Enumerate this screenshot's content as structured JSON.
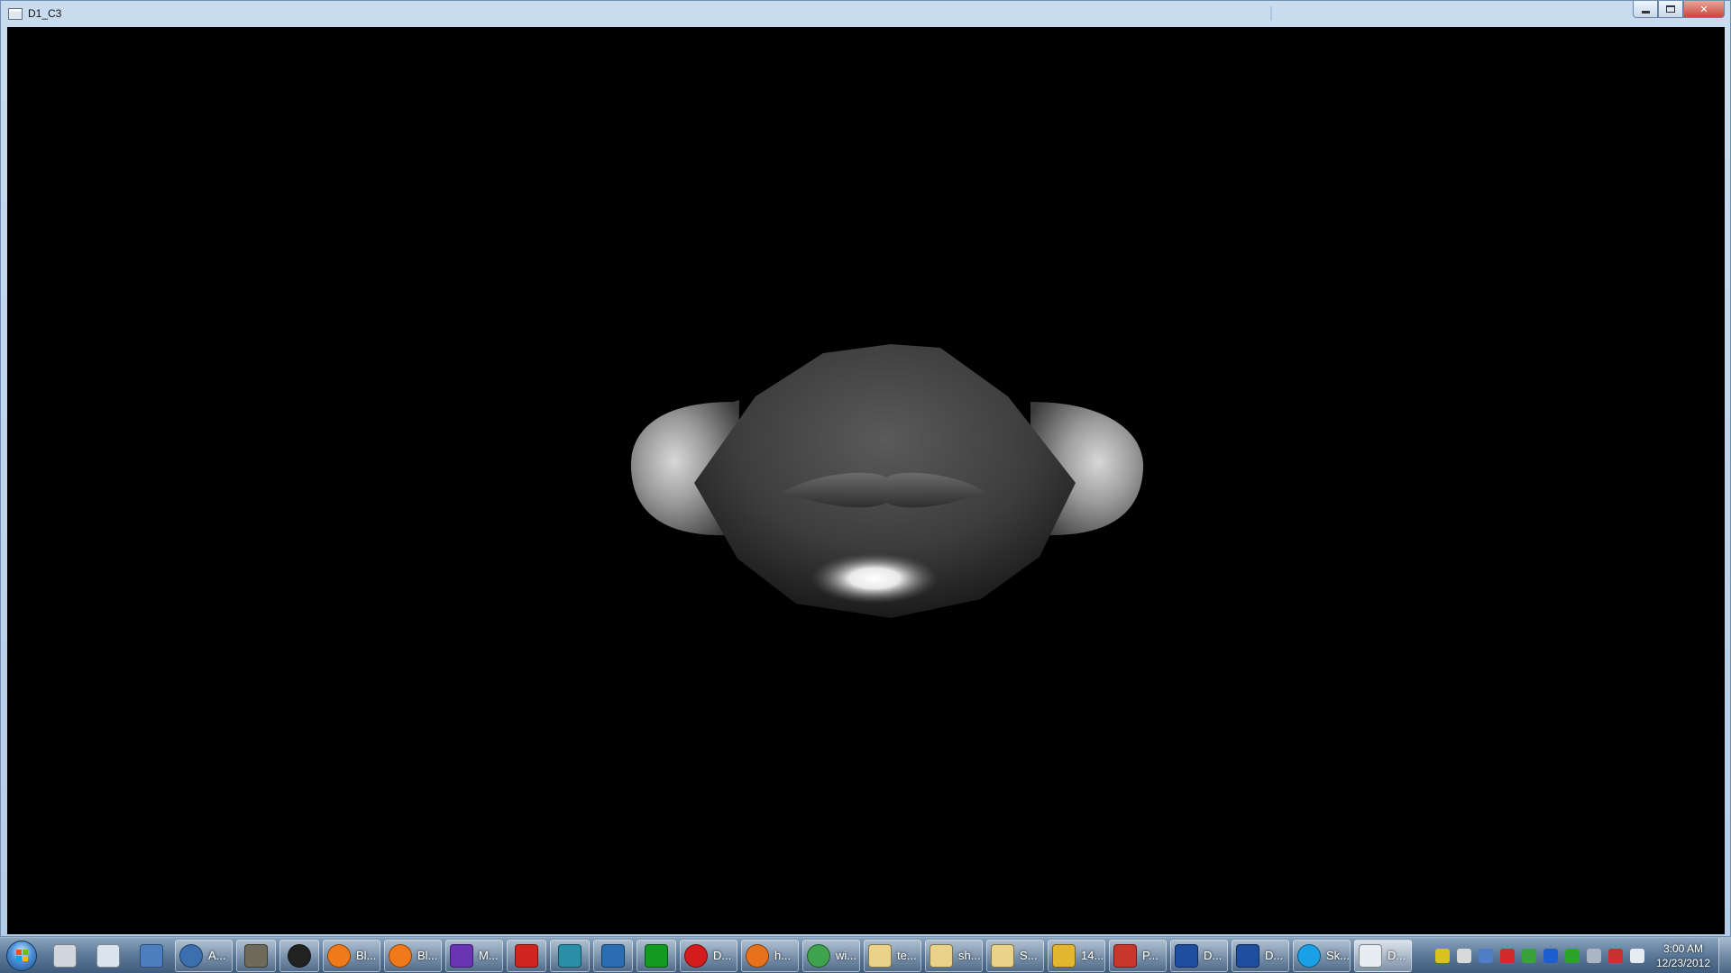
{
  "window": {
    "title": "D1_C3"
  },
  "taskbar": {
    "quick_launch": [
      {
        "name": "drive-icon",
        "color": "#cfd6de"
      },
      {
        "name": "calculator-icon",
        "color": "#d9e4ef"
      },
      {
        "name": "media-player-icon",
        "color": "#4d7fbf"
      }
    ],
    "buttons": [
      {
        "name": "taskbar-button-a",
        "label": "A...",
        "icon": "media-icon",
        "color": "#3b6fb0",
        "round": true
      },
      {
        "name": "taskbar-icon-gimp",
        "label": "",
        "icon": "gimp-icon",
        "color": "#6d6a5b",
        "round": false
      },
      {
        "name": "taskbar-icon-app",
        "label": "",
        "icon": "swirl-icon",
        "color": "#222222",
        "round": true
      },
      {
        "name": "taskbar-button-blender-1",
        "label": "Bl...",
        "icon": "blender-icon",
        "color": "#f07a1a",
        "round": true
      },
      {
        "name": "taskbar-button-blender-2",
        "label": "Bl...",
        "icon": "blender-icon",
        "color": "#f07a1a",
        "round": true
      },
      {
        "name": "taskbar-button-m",
        "label": "M...",
        "icon": "star-icon",
        "color": "#6a35b5",
        "round": false
      },
      {
        "name": "taskbar-icon-red",
        "label": "",
        "icon": "red-app-icon",
        "color": "#d0261f",
        "round": false
      },
      {
        "name": "taskbar-icon-teal",
        "label": "",
        "icon": "teal-app-icon",
        "color": "#2a8fa6",
        "round": false
      },
      {
        "name": "taskbar-icon-blue",
        "label": "",
        "icon": "blue-app-icon",
        "color": "#2b6db3",
        "round": false
      },
      {
        "name": "taskbar-icon-green",
        "label": "",
        "icon": "green-app-icon",
        "color": "#139a21",
        "round": false
      },
      {
        "name": "taskbar-button-opera",
        "label": "D...",
        "icon": "opera-icon",
        "color": "#d41c1c",
        "round": true
      },
      {
        "name": "taskbar-button-firefox",
        "label": "h...",
        "icon": "firefox-icon",
        "color": "#e8711c",
        "round": true
      },
      {
        "name": "taskbar-button-chrome",
        "label": "wi...",
        "icon": "chrome-icon",
        "color": "#3fa34d",
        "round": true
      },
      {
        "name": "taskbar-button-folder-1",
        "label": "te...",
        "icon": "folder-icon",
        "color": "#e9d38a",
        "round": false
      },
      {
        "name": "taskbar-button-folder-2",
        "label": "sh...",
        "icon": "folder-icon",
        "color": "#e9d38a",
        "round": false
      },
      {
        "name": "taskbar-button-folder-3",
        "label": "S...",
        "icon": "folder-icon",
        "color": "#e9d38a",
        "round": false
      },
      {
        "name": "taskbar-button-14",
        "label": "14...",
        "icon": "lightning-icon",
        "color": "#e4b52e",
        "round": false
      },
      {
        "name": "taskbar-button-p",
        "label": "P...",
        "icon": "santa-icon",
        "color": "#c8362e",
        "round": false
      },
      {
        "name": "taskbar-button-dev-1",
        "label": "D...",
        "icon": "dev-icon",
        "color": "#1f4ea1",
        "round": false
      },
      {
        "name": "taskbar-button-dev-2",
        "label": "D...",
        "icon": "dev-icon",
        "color": "#1f4ea1",
        "round": false
      },
      {
        "name": "taskbar-button-skype",
        "label": "Sk...",
        "icon": "skype-icon",
        "color": "#1aa0e6",
        "round": true
      },
      {
        "name": "taskbar-button-d-active",
        "label": "D...",
        "icon": "window-icon",
        "color": "#e7edf3",
        "round": false,
        "active": true
      }
    ],
    "tray": [
      {
        "name": "tray-icon-1",
        "color": "#d9c21d"
      },
      {
        "name": "tray-icon-2",
        "color": "#d9d9d9"
      },
      {
        "name": "tray-icon-3",
        "color": "#4f7ec7"
      },
      {
        "name": "tray-icon-4",
        "color": "#d12a2a"
      },
      {
        "name": "tray-icon-5",
        "color": "#3aa23a"
      },
      {
        "name": "bluetooth-icon",
        "color": "#1d5fd1"
      },
      {
        "name": "utorrent-icon",
        "color": "#2aa52a"
      },
      {
        "name": "tray-icon-8",
        "color": "#aab6c3"
      },
      {
        "name": "tray-icon-9",
        "color": "#c8312e"
      },
      {
        "name": "volume-icon",
        "color": "#e6ecf2"
      }
    ],
    "clock": {
      "time": "3:00 AM",
      "date": "12/23/2012"
    }
  }
}
